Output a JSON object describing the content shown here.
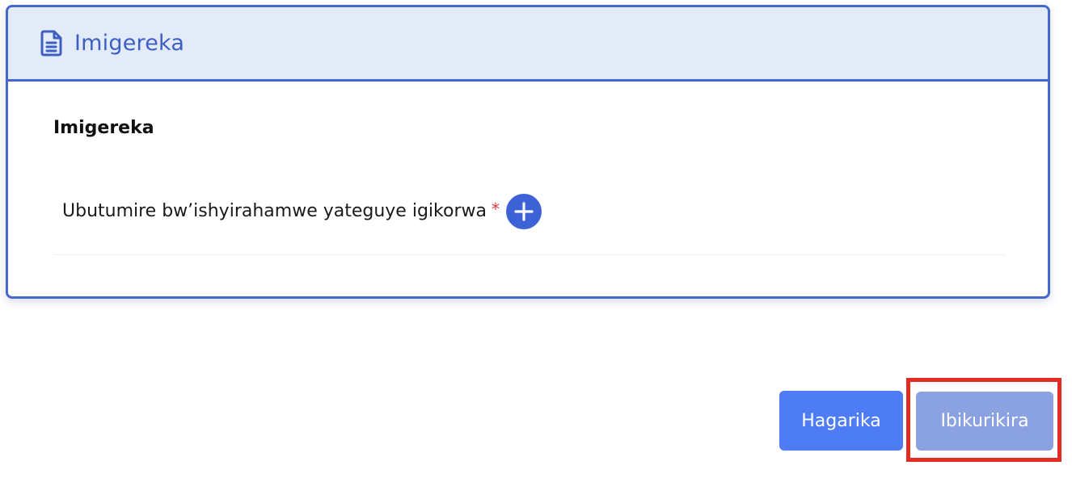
{
  "panel": {
    "header_title": "Imigereka",
    "header_icon": "document-icon",
    "section_title": "Imigereka",
    "field_label": "Ubutumire bw’ishyirahamwe yateguye igikorwa",
    "required_mark": "*",
    "add_icon": "plus-icon"
  },
  "actions": {
    "cancel_label": "Hagarika",
    "next_label": "Ibikurikira"
  },
  "colors": {
    "accent": "#4468cc",
    "header_bg": "#e3ebf8",
    "cancel_button": "#4d7cf5",
    "next_button": "#8aa1e2",
    "required": "#e0313f",
    "highlight": "#e02d21"
  }
}
